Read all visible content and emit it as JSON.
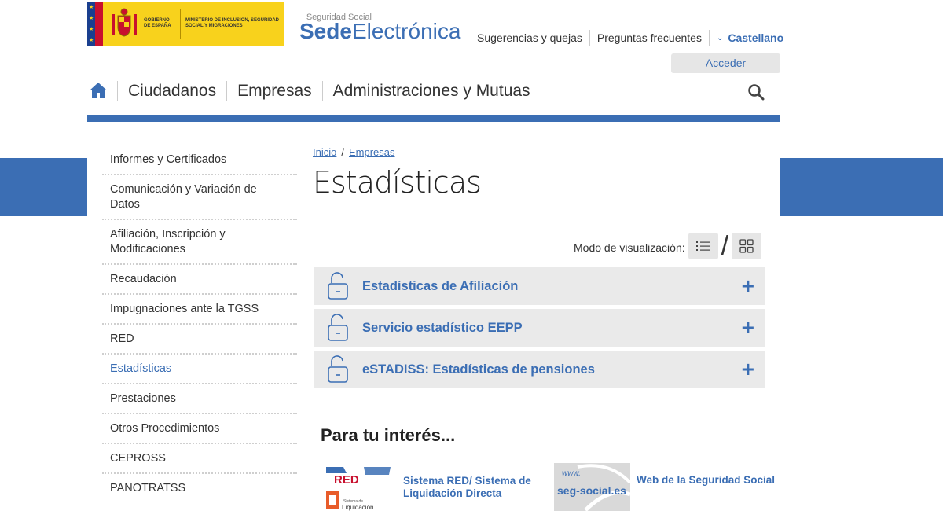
{
  "header": {
    "gov_logo": {
      "gobierno": "GOBIERNO DE ESPAÑA",
      "ministerio": "MINISTERIO DE INCLUSIÓN, SEGURIDAD SOCIAL Y MIGRACIONES"
    },
    "sede_logo": {
      "small": "Seguridad Social",
      "bold": "Sede",
      "light": "Electrónica"
    },
    "top_links": [
      "Sugerencias y quejas",
      "Preguntas frecuentes"
    ],
    "language": "Castellano",
    "login_label": "Acceder"
  },
  "nav": {
    "items": [
      "Ciudadanos",
      "Empresas",
      "Administraciones y Mutuas"
    ]
  },
  "sidebar": {
    "items": [
      {
        "label": "Informes y Certificados"
      },
      {
        "label": "Comunicación y Variación de Datos"
      },
      {
        "label": "Afiliación, Inscripción y Modificaciones"
      },
      {
        "label": "Recaudación"
      },
      {
        "label": "Impugnaciones ante la TGSS"
      },
      {
        "label": "RED"
      },
      {
        "label": "Estadísticas",
        "active": true
      },
      {
        "label": "Prestaciones"
      },
      {
        "label": "Otros Procedimientos"
      },
      {
        "label": "CEPROSS"
      },
      {
        "label": "PANOTRATSS"
      }
    ]
  },
  "breadcrumb": {
    "items": [
      "Inicio",
      "Empresas"
    ],
    "separator": "/"
  },
  "page_title": "Estadísticas",
  "view_mode": {
    "label": "Modo de visualización:",
    "separator": "/"
  },
  "accordion": [
    {
      "title": "Estadísticas de Afiliación"
    },
    {
      "title": "Servicio estadístico EEPP"
    },
    {
      "title": "eSTADISS: Estadísticas de pensiones"
    }
  ],
  "interest": {
    "title": "Para tu interés...",
    "cards": [
      {
        "title": "Sistema RED/ Sistema de Liquidación Directa",
        "thumb_text": "RED",
        "thumb_sub": "Liquidación",
        "thumb_caption": "Sistema de"
      },
      {
        "title": "Web de la Seguridad Social",
        "thumb_text": "seg-social.es",
        "thumb_www": "www."
      }
    ]
  },
  "colors": {
    "brand_blue": "#3b6eb4",
    "gov_yellow": "#f8d21c",
    "accordion_bg": "#eaeaea"
  }
}
